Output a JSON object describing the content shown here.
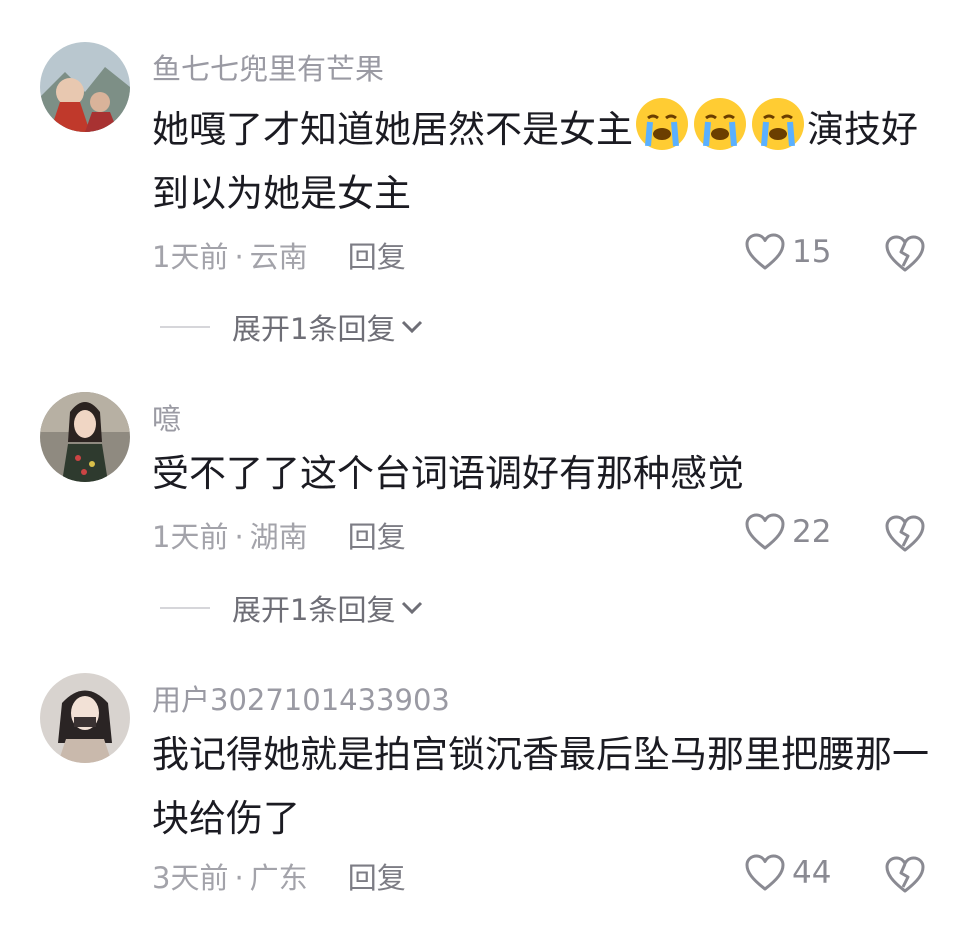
{
  "comments": [
    {
      "username": "鱼七七兜里有芒果",
      "text_lines": [
        "她嘎了才知道她居然不是女主",
        "演技好",
        "到以为她是女主"
      ],
      "emoji": "loudly-crying-face-emoji",
      "time": "1天前",
      "location": "云南",
      "reply_label": "回复",
      "likes": "15",
      "expand_label": "展开1条回复"
    },
    {
      "username": "噫",
      "text_lines": [
        "受不了了这个台词语调好有那种感觉"
      ],
      "time": "1天前",
      "location": "湖南",
      "reply_label": "回复",
      "likes": "22",
      "expand_label": "展开1条回复"
    },
    {
      "username": "用户3027101433903",
      "text_lines": [
        "我记得她就是拍宫锁沉香最后坠马那里把腰那一",
        "块给伤了"
      ],
      "time": "3天前",
      "location": "广东",
      "reply_label": "回复",
      "likes": "44"
    }
  ],
  "separator": "·",
  "icons": {
    "like": "heart-outline-icon",
    "dislike": "broken-heart-icon",
    "expand": "chevron-down-icon"
  },
  "colors": {
    "text": "#1b1b22",
    "muted": "#a3a3aa",
    "username": "#9a9aa3"
  }
}
